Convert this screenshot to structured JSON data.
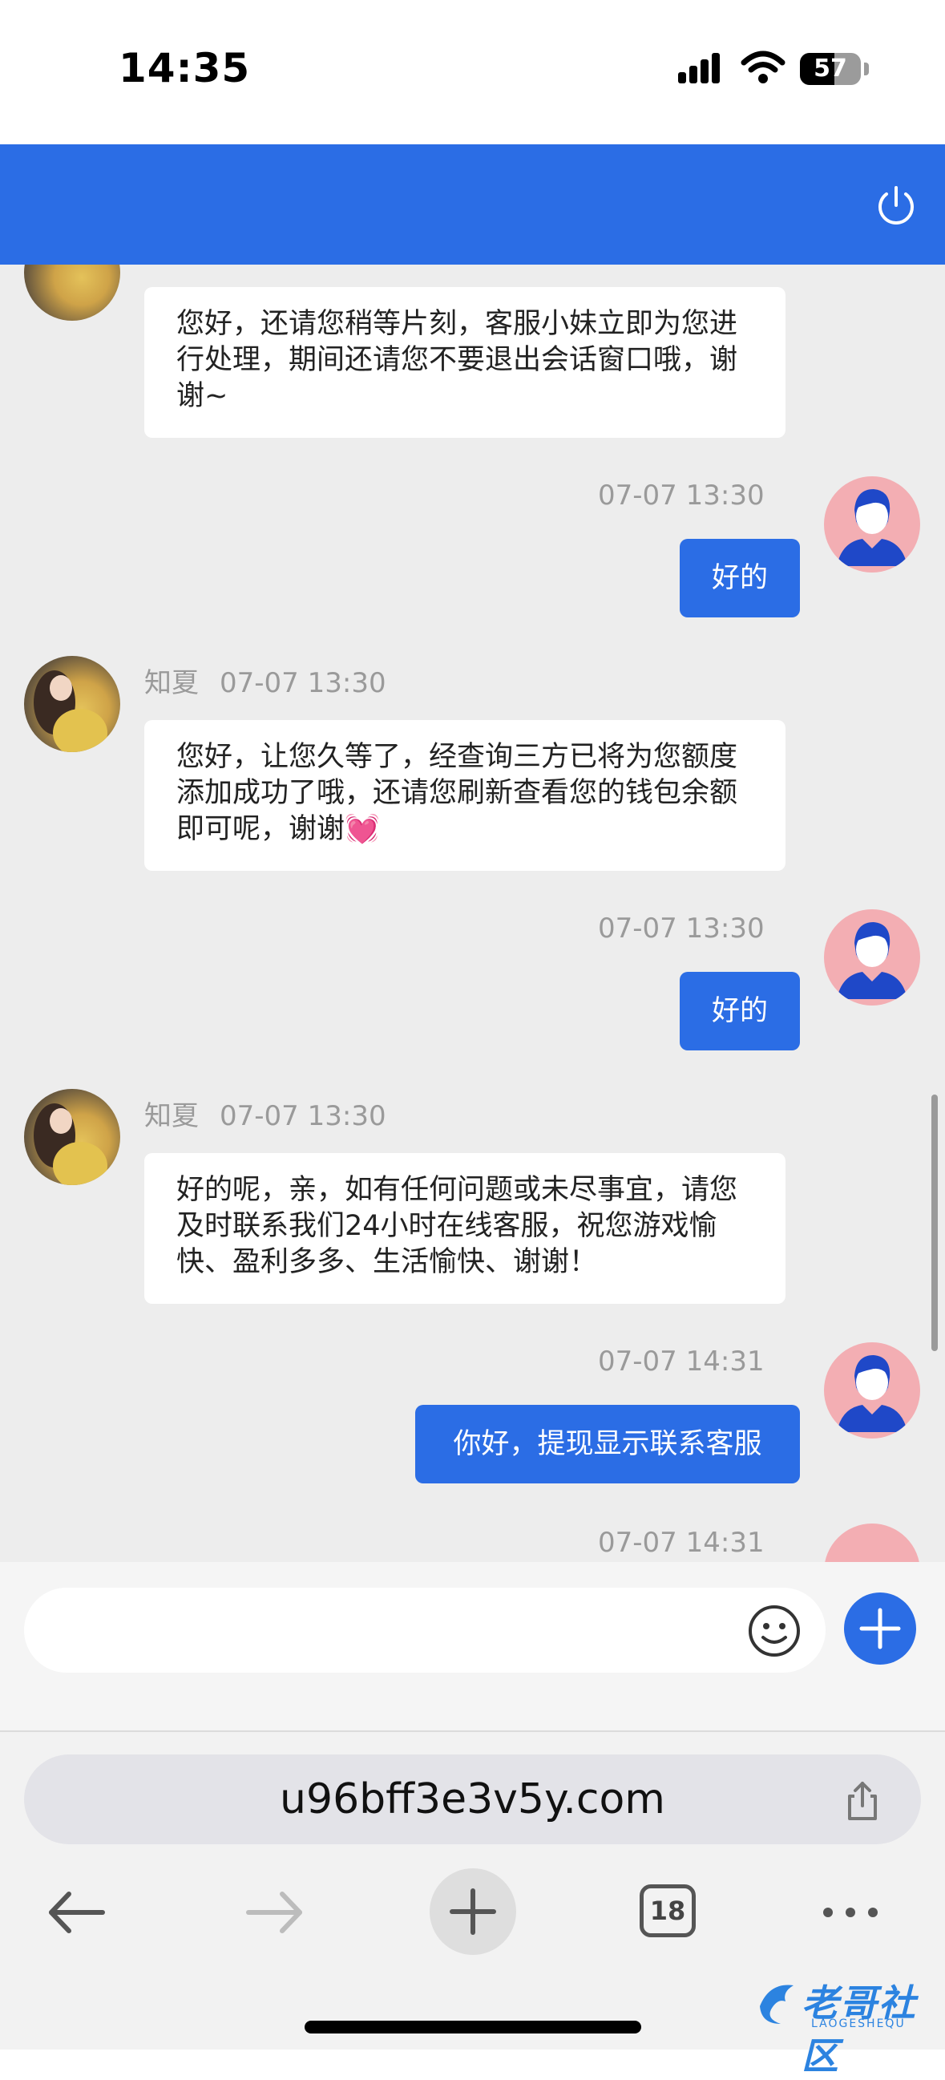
{
  "status_bar": {
    "time": "14:35",
    "battery": "57",
    "battery_level": 0.57
  },
  "header": {
    "power_icon": "power-icon"
  },
  "messages": [
    {
      "side": "in",
      "text": "您好，还请您稍等片刻，客服小妹立即为您进行处理，期间还请您不要退出会话窗口哦，谢谢~"
    },
    {
      "side": "out",
      "time": "07-07 13:30",
      "text": "好的"
    },
    {
      "side": "in",
      "name": "知夏",
      "time": "07-07 13:30",
      "text": "您好，让您久等了，经查询三方已将为您额度添加成功了哦，还请您刷新查看您的钱包余额即可呢，谢谢💓"
    },
    {
      "side": "out",
      "time": "07-07 13:30",
      "text": "好的"
    },
    {
      "side": "in",
      "name": "知夏",
      "time": "07-07 13:30",
      "text": "好的呢，亲，如有任何问题或未尽事宜，请您及时联系我们24小时在线客服，祝您游戏愉快、盈利多多、生活愉快、谢谢！"
    },
    {
      "side": "out",
      "time": "07-07 14:31",
      "text": "你好，提现显示联系客服"
    },
    {
      "side": "out",
      "time": "07-07 14:31",
      "text": ""
    }
  ],
  "composer": {
    "placeholder": "",
    "emoji_icon": "smiley-icon",
    "add_icon": "plus-icon"
  },
  "browser": {
    "url": "u96bff3e3v5y.com",
    "tab_count": "18",
    "icons": [
      "back-arrow-icon",
      "forward-arrow-icon",
      "new-tab-plus-icon",
      "tabs-icon",
      "more-dots-icon",
      "share-icon"
    ]
  },
  "watermark": {
    "text": "老哥社区",
    "sub": "LAOGESHEQU"
  },
  "colors": {
    "accent": "#2b6de5",
    "chat_bg": "#ededed",
    "bubble_in": "#ffffff",
    "user_avatar_bg": "#f3aeb3"
  }
}
